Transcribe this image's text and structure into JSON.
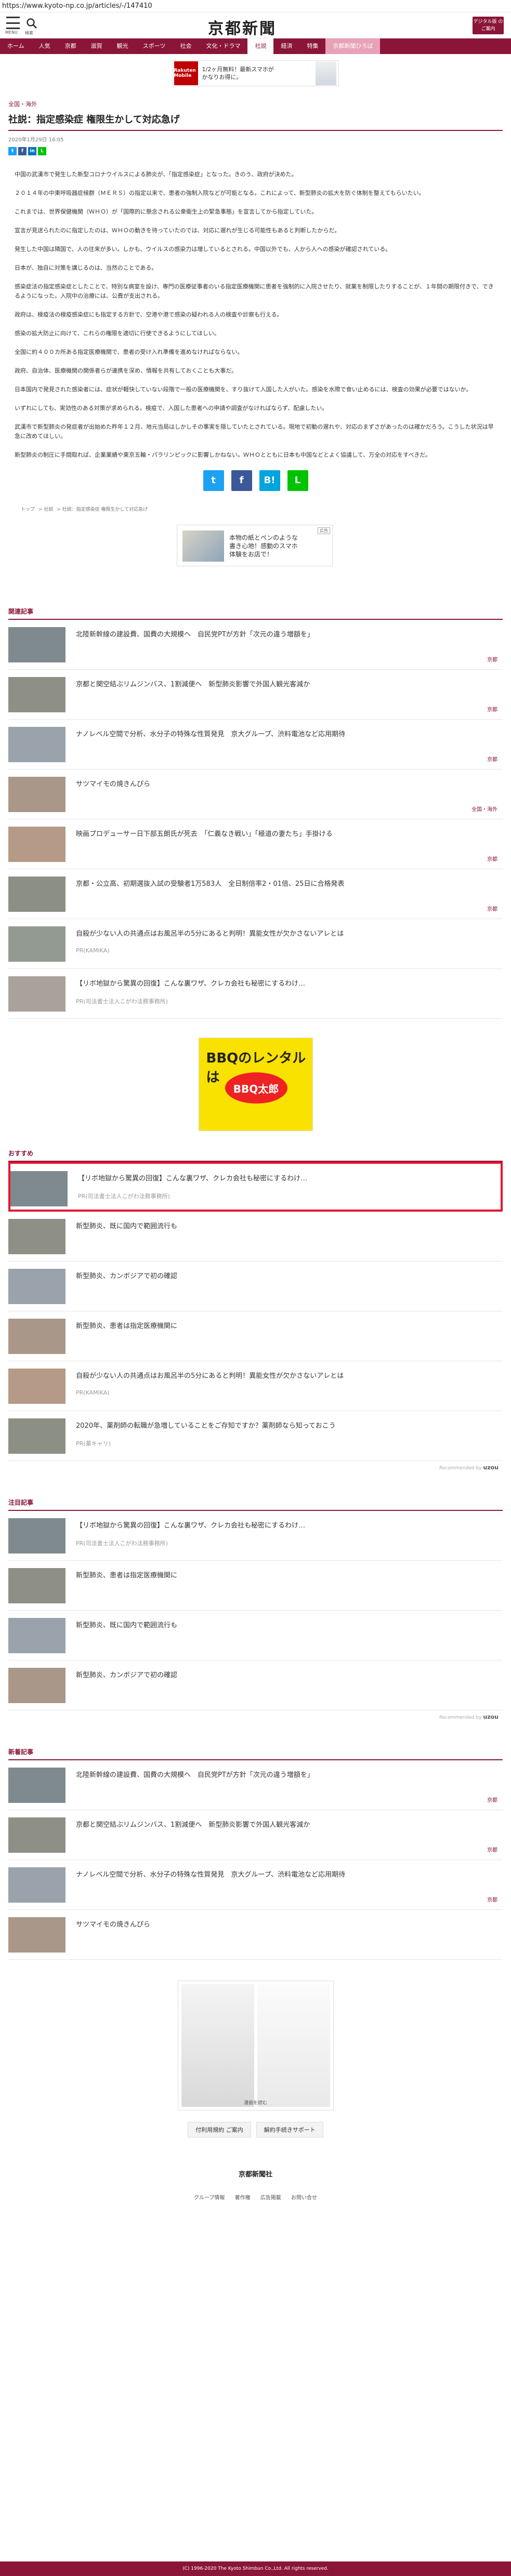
{
  "url": "https://www.kyoto-np.co.jp/articles/-/147410",
  "header": {
    "menu_label": "MENU",
    "search_label": "検索",
    "logo": "京都新聞",
    "digital_label": "デジタル版 のご案内"
  },
  "nav": [
    "ホーム",
    "人気",
    "京都",
    "滋賀",
    "観光",
    "スポーツ",
    "社会",
    "文化・ドラマ",
    "社説",
    "経済",
    "特集",
    "京都新聞ひろば"
  ],
  "nav_active": "社説",
  "ad_top": {
    "brand": "Rakuten Mobile",
    "text1": "1/2ヶ月無料！最新スマホが",
    "text2": "かなりお得に。"
  },
  "article": {
    "category": "全国・海外",
    "title": "社説：指定感染症 権限生かして対応急げ",
    "date": "2020年1月29日 16:05",
    "paragraphs": [
      "中国の武漢市で発生した新型コロナウイルスによる肺炎が、「指定感染症」となった。きのう、政府が決めた。",
      "２０１４年の中東呼吸器症候群（ＭＥＲＳ）の指定以来で、患者の強制入院などが可能となる。これによって、新型肺炎の拡大を防ぐ体制を整えてもらいたい。",
      "これまでは、世界保健機関（ＷＨＯ）が「国際的に懸念される公衆衛生上の緊急事態」を宣言してから指定していた。",
      "宣言が見送られたのに指定したのは、ＷＨＯの動きを待っていたのでは、対応に遅れが生じる可能性もあると判断したからだ。",
      "発生した中国は隣国で、人の往来が多い。しかも、ウイルスの感染力は増しているとされる。中国以外でも、人から人への感染が確認されている。",
      "日本が、独自に対策を講じるのは、当然のことである。",
      "感染症法の指定感染症としたことで、特別な病室を設け、専門の医療従事者のいる指定医療機関に患者を強制的に入院させたり、就業を制限したりすることが、１年間の期限付きで、できるようになった。入院中の治療には、公費が支出される。",
      "政府は、検疫法の検疫感染症にも指定する方針で、空港や港で感染の疑われる人の検査や診察も行える。",
      "感染の拡大防止に向けて、これらの権限を適切に行使できるようにしてほしい。",
      "全国に約４００カ所ある指定医療機関で、患者の受け入れ準備を進めなければならない。",
      "政府、自治体、医療機関の関係者らが連携を深め、情報を共有しておくことも大事だ。",
      "日本国内で発見された感染者には、症状が軽快していない段階で一般の医療機関を、すり抜けて入国した人がいた。感染を水際で食い止めるには、検査の効果が必要ではないか。",
      "いずれにしても、実効性のある対策が求められる。検疫で、入国した患者への申請や調査がなければならず、配慮したい。",
      "武漢市で新型肺炎の発症者が出始めた昨年１２月、地元当局はしかしその事実を隠していたとされている。現地で初動の遅れや、対応のまずさがあったのは確かだろう。こうした状況は早急に改めてほしい。",
      "新型肺炎の制圧に手間取れば、企業業績や東京五輪・パラリンピックに影響しかねない。ＷＨＯとともに日本も中国などとよく協議して、万全の対応をすべきだ。"
    ],
    "share_small": [
      "t",
      "f",
      "in",
      "L"
    ],
    "share_big": [
      "t",
      "f",
      "B!",
      "L"
    ]
  },
  "breadcrumb": [
    "トップ",
    "社説",
    "社説：指定感染症 権限生かして対応急げ"
  ],
  "ad_mid": {
    "text1": "本物の紙とペンのような",
    "text2": "書き心地！感動のスマホ",
    "text3": "体験をお店で！",
    "tag": "広告"
  },
  "related": {
    "heading": "関連記事",
    "items": [
      {
        "title": "北陸新幹線の建設費、国費の大規模へ　自民党PTが方針「次元の違う増額を」",
        "tag": "京都"
      },
      {
        "title": "京都と関空結ぶリムジンバス、1割減便へ　新型肺炎影響で外国人観光客減か",
        "tag": "京都"
      },
      {
        "title": "ナノレベル空間で分析、水分子の特殊な性質発見　京大グループ、渋料電池など応用期待",
        "tag": "京都"
      },
      {
        "title": "サツマイモの焼きんぴら",
        "tag": "全国・海外"
      },
      {
        "title": "映画プロデューサー日下部五朗氏が死去　「仁義なき戦い」「極道の妻たち」手掛ける",
        "tag": "京都"
      },
      {
        "title": "京都・公立高、初期選抜入試の受験者1万583人　全日制倍率2・01倍、25日に合格発表",
        "tag": "京都"
      },
      {
        "title": "自殺が少ない人の共通点はお風呂半の5分にあると判明！異能女性が欠かさないアレとは",
        "pr": "PR(KAMIKA)"
      },
      {
        "title": "【リボ地獄から驚異の回復】こんな裏ワザ、クレカ会社も秘密にするわけ…",
        "pr": "PR(司法書士法人こがわ法務事務所)"
      }
    ]
  },
  "ad_bbq": {
    "text1": "BBQのレンタルは",
    "text2": "BBQ太郎"
  },
  "recommend": {
    "heading": "おすすめ",
    "items": [
      {
        "title": "【リボ地獄から驚異の回復】こんな裏ワザ、クレカ会社も秘密にするわけ…",
        "pr": "PR(司法書士法人こがわ法務事務所)"
      },
      {
        "title": "新型肺炎、既に国内で範囲流行も"
      },
      {
        "title": "新型肺炎、カンボジアで初の確認"
      },
      {
        "title": "新型肺炎、患者は指定医療機関に"
      },
      {
        "title": "自殺が少ない人の共通点はお風呂半の5分にあると判明！異能女性が欠かさないアレとは",
        "pr": "PR(KAMIKA)"
      },
      {
        "title": "2020年、薬剤師の転職が急増していることをご存知ですか？薬剤師なら知っておこう",
        "pr": "PR(薬キャリ)"
      }
    ],
    "powered": "Recommended by",
    "powered_brand": "uzou"
  },
  "notable": {
    "heading": "注目記事",
    "items": [
      {
        "title": "【リボ地獄から驚異の回復】こんな裏ワザ、クレカ会社も秘密にするわけ…",
        "pr": "PR(司法書士法人こがわ法務事務所)"
      },
      {
        "title": "新型肺炎、患者は指定医療機関に"
      },
      {
        "title": "新型肺炎、既に国内で範囲流行も"
      },
      {
        "title": "新型肺炎、カンボジアで初の確認"
      }
    ],
    "powered": "Recommended by",
    "powered_brand": "uzou"
  },
  "latest": {
    "heading": "新着記事",
    "items": [
      {
        "title": "北陸新幹線の建設費、国費の大規模へ　自民党PTが方針「次元の違う増額を」",
        "tag": "京都"
      },
      {
        "title": "京都と関空結ぶリムジンバス、1割減便へ　新型肺炎影響で外国人観光客減か",
        "tag": "京都"
      },
      {
        "title": "ナノレベル空間で分析、水分子の特殊な性質発見　京大グループ、渋料電池など応用期待",
        "tag": "京都"
      },
      {
        "title": "サツマイモの焼きんぴら",
        "tag": ""
      }
    ]
  },
  "ad_bottom": {
    "caption": "漫画を読む"
  },
  "footer": {
    "buttons": [
      "付利用規約 ご案内",
      "解約手続きサポート"
    ],
    "logo": "京都新聞社",
    "links": [
      "グループ情報",
      "著作権",
      "広告掲載",
      "お問い合せ"
    ],
    "copyright": "(C) 1996-2020 The Kyoto Shimbun Co.,Ltd. All rights reserved."
  }
}
